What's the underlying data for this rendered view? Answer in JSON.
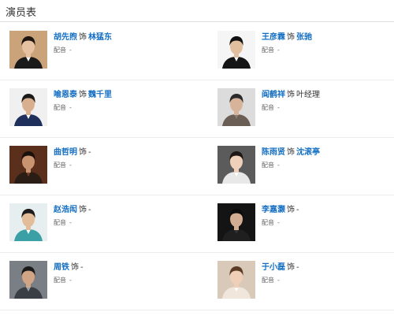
{
  "section": {
    "title": "演员表"
  },
  "cast": [
    {
      "actor": "胡先煦",
      "as": "饰",
      "role": "林猛东",
      "role_link": true,
      "voice_label": "配音",
      "voice": "-",
      "photo": {
        "bg": "#caa37a",
        "hair": "#1e1410",
        "skin": "#e7c2a2",
        "shirt": "#1a1a1a",
        "accent": "#ffffff"
      }
    },
    {
      "actor": "王彦霖",
      "as": "饰",
      "role": "张驰",
      "role_link": true,
      "voice_label": "配音",
      "voice": "-",
      "photo": {
        "bg": "#f5f5f5",
        "hair": "#111111",
        "skin": "#e2bf9f",
        "shirt": "#151515",
        "accent": "#ffffff"
      }
    },
    {
      "actor": "喻恩泰",
      "as": "饰",
      "role": "魏千里",
      "role_link": true,
      "voice_label": "配音",
      "voice": "-",
      "photo": {
        "bg": "#f0f0f0",
        "hair": "#1a1a1a",
        "skin": "#d9b08f",
        "shirt": "#1d2f5a",
        "accent": "#ffffff"
      }
    },
    {
      "actor": "阎鹤祥",
      "as": "饰",
      "role": "叶经理",
      "role_link": false,
      "voice_label": "配音",
      "voice": "-",
      "photo": {
        "bg": "#dcdcdc",
        "hair": "#2a2a2a",
        "skin": "#d7b499",
        "shirt": "#6b5f55",
        "accent": "#8a7d70"
      }
    },
    {
      "actor": "曲哲明",
      "as": "饰",
      "role": "-",
      "role_link": false,
      "voice_label": "配音",
      "voice": "-",
      "photo": {
        "bg": "#5a2f1c",
        "hair": "#1b110c",
        "skin": "#c99470",
        "shirt": "#2a1d16",
        "accent": "#7a3f22"
      }
    },
    {
      "actor": "陈雨贤",
      "as": "饰",
      "role": "沈滚亭",
      "role_link": true,
      "voice_label": "配音",
      "voice": "-",
      "photo": {
        "bg": "#5b5b5b",
        "hair": "#1d1815",
        "skin": "#efd0bb",
        "shirt": "#e8e8e8",
        "accent": "#ffffff"
      }
    },
    {
      "actor": "赵浩闳",
      "as": "饰",
      "role": "-",
      "role_link": false,
      "voice_label": "配音",
      "voice": "-",
      "photo": {
        "bg": "#e6eef0",
        "hair": "#1c1c1c",
        "skin": "#e3bc99",
        "shirt": "#3ba0a6",
        "accent": "#ffffff"
      }
    },
    {
      "actor": "李嘉灏",
      "as": "饰",
      "role": "-",
      "role_link": false,
      "voice_label": "配音",
      "voice": "-",
      "photo": {
        "bg": "#141414",
        "hair": "#0c0c0c",
        "skin": "#d2ad92",
        "shirt": "#1f1f1f",
        "accent": "#333333"
      }
    },
    {
      "actor": "周铁",
      "as": "饰",
      "role": "-",
      "role_link": false,
      "voice_label": "配音",
      "voice": "-",
      "photo": {
        "bg": "#7a7f85",
        "hair": "#1a1a1a",
        "skin": "#cfa586",
        "shirt": "#3a3f45",
        "accent": "#9aa3ab"
      }
    },
    {
      "actor": "于小磊",
      "as": "饰",
      "role": "-",
      "role_link": false,
      "voice_label": "配音",
      "voice": "-",
      "photo": {
        "bg": "#d8c9b8",
        "hair": "#5a3b26",
        "skin": "#efcfb8",
        "shirt": "#f0e6dc",
        "accent": "#ffffff"
      }
    }
  ]
}
